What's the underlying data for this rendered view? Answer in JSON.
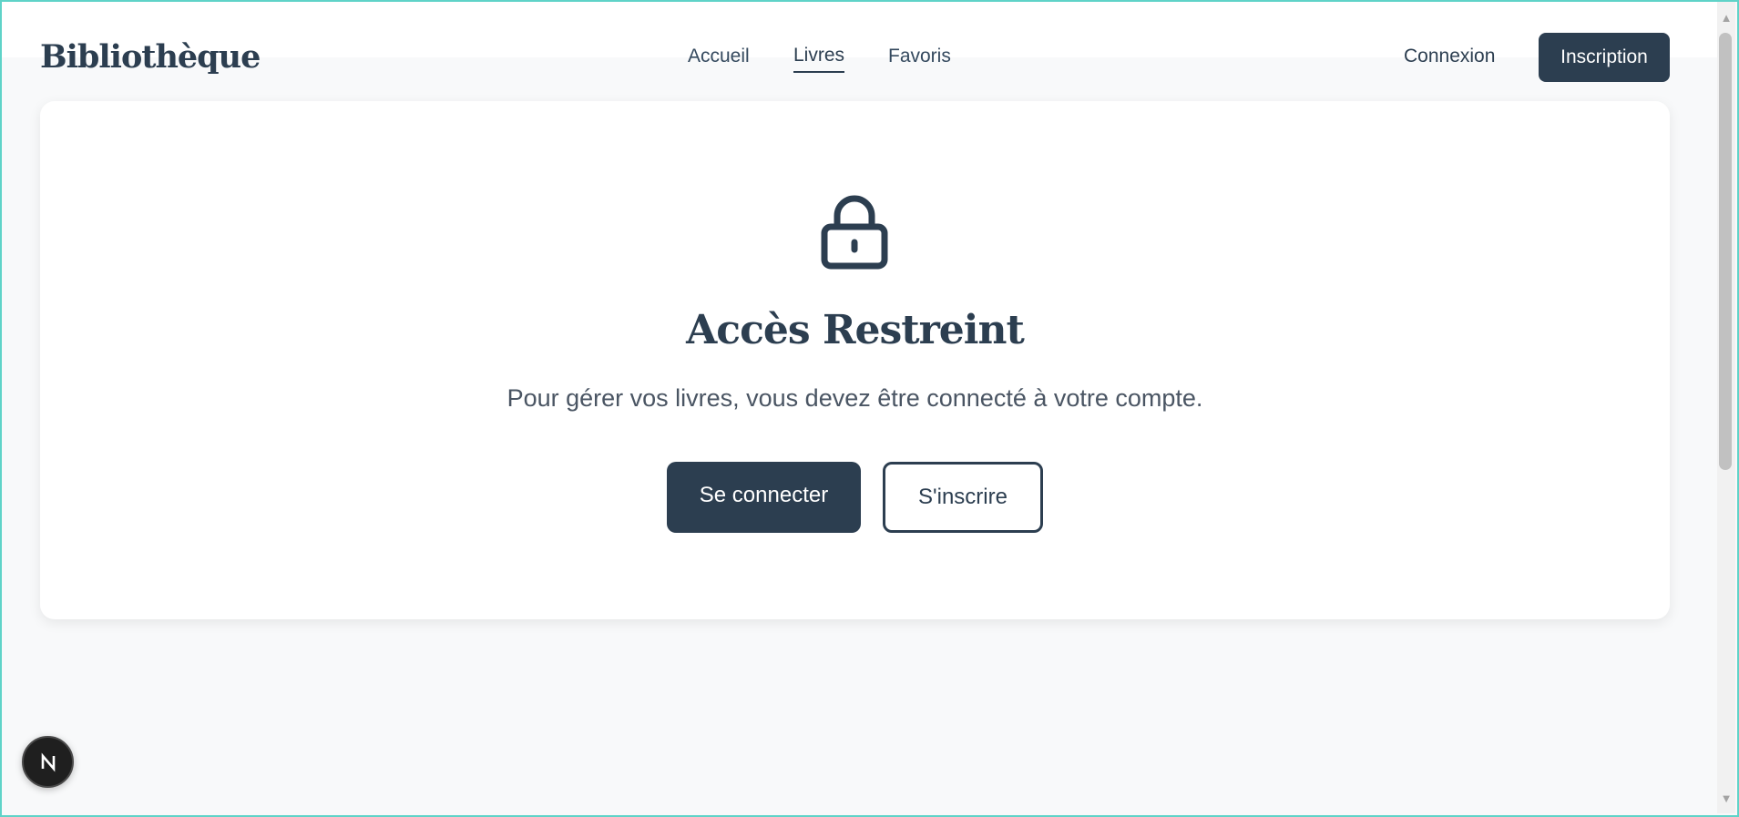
{
  "header": {
    "logo": "Bibliothèque",
    "nav": {
      "home": "Accueil",
      "books": "Livres",
      "favorites": "Favoris"
    },
    "login_label": "Connexion",
    "signup_label": "Inscription"
  },
  "restricted": {
    "icon": "lock-icon",
    "title": "Accès Restreint",
    "message": "Pour gérer vos livres, vous devez être connecté à votre compte.",
    "login_button": "Se connecter",
    "signup_button": "S'inscrire"
  },
  "dev_badge": {
    "icon": "nextjs-icon"
  },
  "colors": {
    "primary": "#2c3e50",
    "background": "#f8f9fa",
    "card": "#ffffff",
    "frame_border": "#5fd3c8"
  }
}
